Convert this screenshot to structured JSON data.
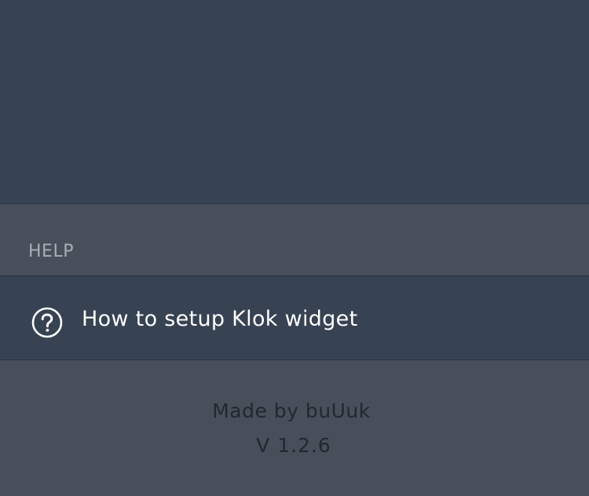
{
  "help_section": {
    "header": "HELP",
    "items": [
      {
        "label": "How to setup Klok widget",
        "icon": "help-circle-icon"
      }
    ]
  },
  "footer": {
    "made_by": "Made by buUuk",
    "version": "V 1.2.6"
  },
  "colors": {
    "background": "#374252",
    "section_background": "#464f5a",
    "text_primary": "#ffffff",
    "text_muted": "#a9aeb5",
    "footer_text": "#22282f"
  }
}
